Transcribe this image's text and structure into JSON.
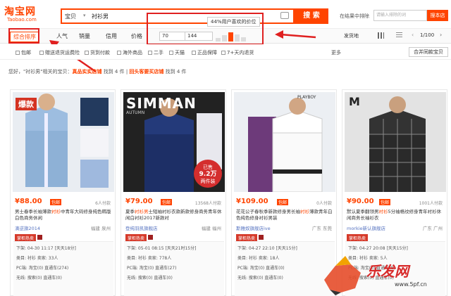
{
  "header": {
    "logo": "淘宝网",
    "logo_sub": "Taobao.com",
    "search_category": "宝贝",
    "search_value": "衬衫男",
    "search_button": "搜 索",
    "shop_search_label": "在结果中排除",
    "shop_search_placeholder": "请输入排除的词",
    "shop_search_button": "搜本店"
  },
  "sortbar": {
    "items": [
      "综合排序",
      "人气",
      "销量",
      "信用",
      "价格"
    ],
    "price_from": "70",
    "price_to": "144",
    "tooltip": "44%用户喜欢的价位",
    "location": "发货地",
    "pager": "1/100"
  },
  "filters": {
    "items": [
      "包邮",
      "赠送退货运费险",
      "货到付款",
      "海外商品",
      "二手",
      "天猫",
      "正品保障",
      "7+天内退货"
    ],
    "more": "更多",
    "merge": "合并同款宝贝"
  },
  "notice": {
    "prefix": "您好，\"衬衫男\"相关的宝贝：",
    "store": "真品实实店铺",
    "count_a": "找到 4 件",
    "sep": " | ",
    "store2": "回头客要买店铺",
    "count_b": "找到 4 件"
  },
  "cards": [
    {
      "price": "¥88.00",
      "tag": "包邮",
      "sales": "6人付款",
      "title_a": "男士春季长袖薄款",
      "title_hl": "衬衫",
      "title_b": "中青年大码修身纯色韩版白色商务休闲",
      "shop": "滴逆旗2014",
      "location": "福建 泉州",
      "badge": "掌柜热卖",
      "info": [
        "下架: 04-30 11:17 [天天18分]",
        "类目: 衬衫 卖家: 33人",
        "PC端: 淘宝(0) 直通车(274)",
        "无线: 搜索(0) 直通车(0)"
      ],
      "image_label": "爆款"
    },
    {
      "price": "¥79.00",
      "tag": "包邮",
      "sales": "13568人付款",
      "title_a": "夏季",
      "title_hl": "衬衫男",
      "title_b": "士短袖衬衫衣款新款修身商务青年休闲白衬衫2017新款衬",
      "shop": "登纯羽凯旗舰店",
      "location": "福建 福州",
      "badge": "掌柜热卖",
      "info": [
        "下架: 05-01 08:15 [天天21时15分]",
        "类目: 衬衫 卖家: 778人",
        "PC端: 淘宝(0) 直通车(27)",
        "无线: 搜索(0) 直通车(0)"
      ],
      "image_label": "SIMMAN",
      "image_sub": "AUTUMN",
      "stamp_a": "已售",
      "stamp_b": "9.2万",
      "stamp_c": "两件装"
    },
    {
      "price": "¥109.00",
      "tag": "包邮",
      "sales": "0人付款",
      "title_a": "花花公子春秋季新款修身男长袖",
      "title_hl": "衬衫",
      "title_b": "薄款青年白色纯色修身衬衫男装",
      "shop": "斯雅奴旗舰店ive",
      "location": "广东 东莞",
      "badge": "掌柜热卖",
      "info": [
        "下架: 04-27 22:10 [天天15分]",
        "类目: 衬衫 卖家: 18人",
        "PC端: 淘宝(0) 直通车(0)",
        "无线: 搜索(0) 直通车(0)"
      ],
      "image_label": "PLAYBOY"
    },
    {
      "price": "¥90.00",
      "tag": "包邮",
      "sales": "1001人付款",
      "title_a": "默认夏季翻领男",
      "title_hl": "衬衫",
      "title_b": "5分袖格纹修身青年衬衫休闲商务长袖衫衣",
      "shop": "morkie新认旗舰店",
      "location": "广东 广州",
      "badge": "掌柜热卖",
      "info": [
        "下架: 04-27 20:08 [天天15分]",
        "类目: 衬衫 卖家: 5人",
        "PC端: 淘宝(0) 直通车(8)",
        "无线: 搜索(0) 直通车(0)"
      ],
      "image_label": "M"
    }
  ],
  "watermark": {
    "text": "乐发网",
    "url": "www.5pf.cn"
  },
  "colors": {
    "accent": "#ff4400",
    "annotation": "#e02020",
    "link": "#5572c0"
  }
}
